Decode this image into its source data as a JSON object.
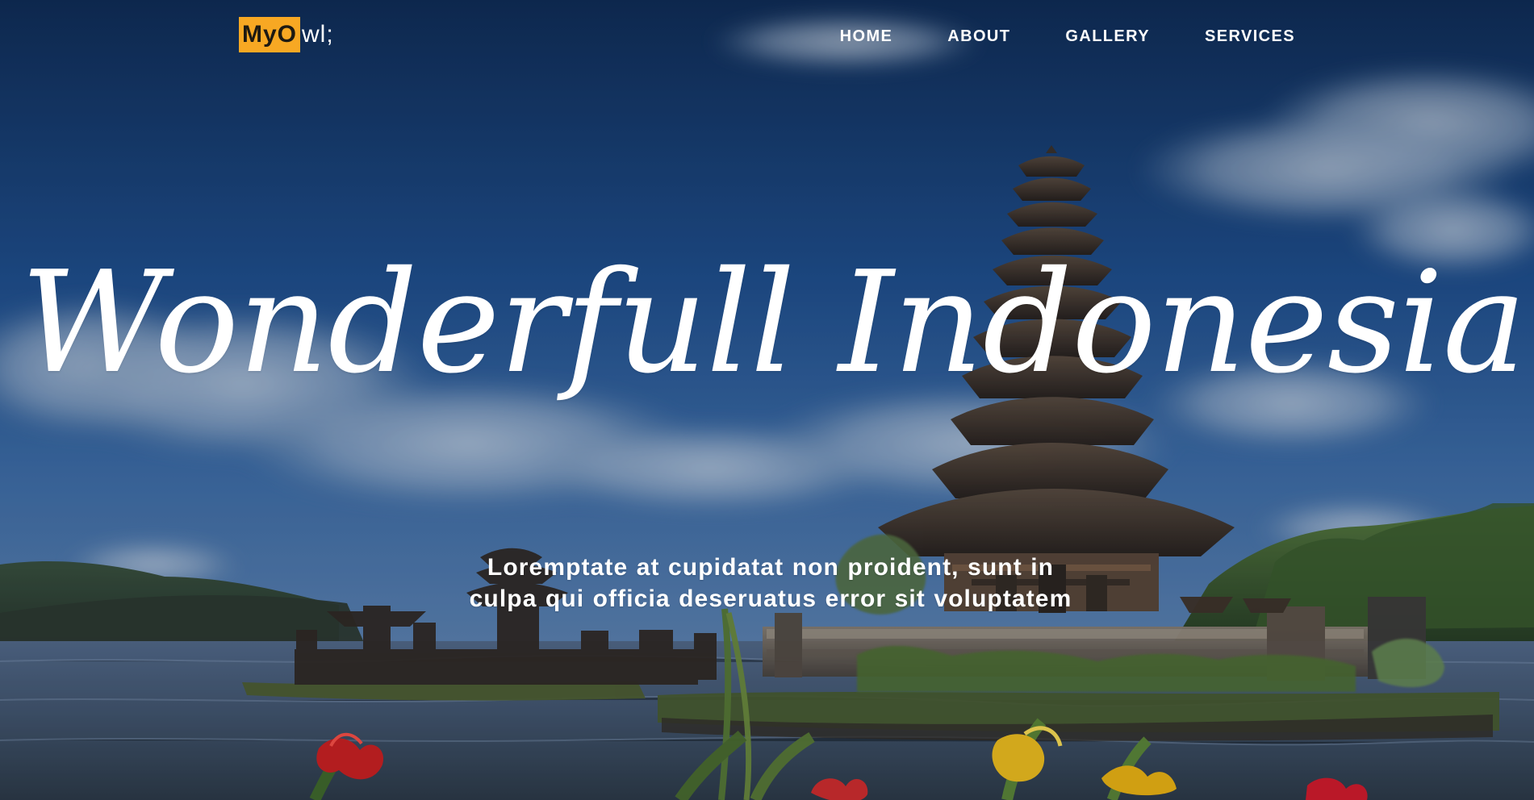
{
  "logo": {
    "badge_text": "MyO",
    "rest_text": "wl;"
  },
  "nav": {
    "items": [
      {
        "label": "HOME"
      },
      {
        "label": "ABOUT"
      },
      {
        "label": "GALLERY"
      },
      {
        "label": "SERVICES"
      }
    ]
  },
  "hero": {
    "title": "Wonderfull Indonesia",
    "description_line_1": "Loremptate at cupidatat non proident, sunt in",
    "description_line_2": "culpa qui officia deseruatus error sit voluptatem"
  },
  "colors": {
    "logo_badge": "#f7a823",
    "text": "#ffffff",
    "sky_dark": "#0f2d5a",
    "sky_mid": "#335f9b",
    "water": "#435a7a",
    "temple": "#45362d",
    "island": "#405b30"
  },
  "icons": {
    "hero_scene": "lake-temple-landscape"
  }
}
